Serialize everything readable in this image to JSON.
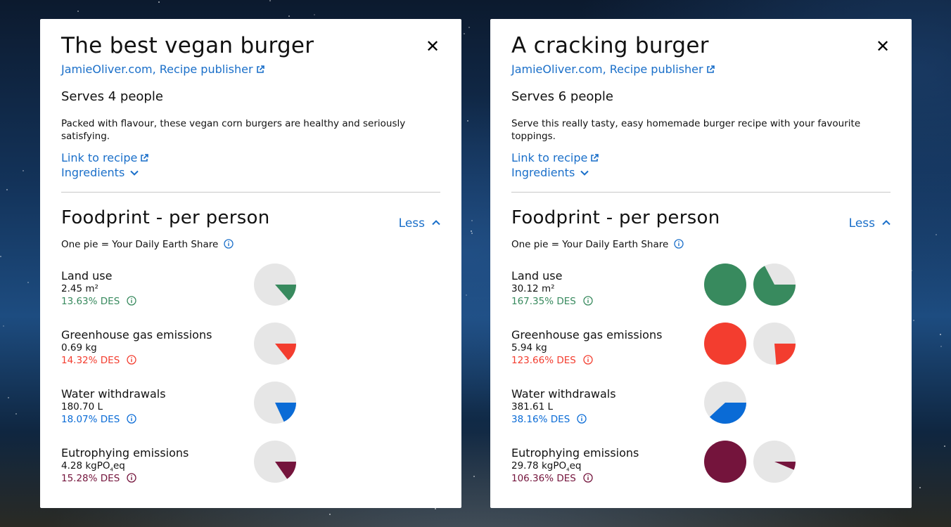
{
  "colors": {
    "link": "#1a6fc9",
    "land": "#388a5e",
    "ghg": "#f33d2f",
    "water": "#0a6bd6",
    "eutro": "#74143c",
    "pie_bg": "#e6e6e6"
  },
  "cards": [
    {
      "title": "The best vegan burger",
      "close_icon": "close-icon",
      "publisher": "JamieOliver.com, Recipe publisher",
      "serves": "Serves 4 people",
      "description": "Packed with flavour, these vegan corn burgers are healthy and seriously satisfying.",
      "recipe_link": "Link to recipe",
      "ingredients": "Ingredients",
      "foodprint_title": "Foodprint - per person",
      "less": "Less",
      "daily_share": "One pie = Your Daily Earth Share",
      "metrics": [
        {
          "name": "Land use",
          "value": "2.45 m²",
          "value_sub": "",
          "value_suffix": "",
          "des": "13.63% DES",
          "color_key": "land",
          "fraction": 0.1363
        },
        {
          "name": "Greenhouse gas emissions",
          "value": "0.69 kg",
          "value_sub": "",
          "value_suffix": "",
          "des": "14.32% DES",
          "color_key": "ghg",
          "fraction": 0.1432
        },
        {
          "name": "Water withdrawals",
          "value": "180.70 L",
          "value_sub": "",
          "value_suffix": "",
          "des": "18.07% DES",
          "color_key": "water",
          "fraction": 0.1807
        },
        {
          "name": "Eutrophying emissions",
          "value": "4.28 kgPO",
          "value_sub": "4",
          "value_suffix": "eq",
          "des": "15.28% DES",
          "color_key": "eutro",
          "fraction": 0.1528
        }
      ]
    },
    {
      "title": "A cracking burger",
      "close_icon": "close-icon",
      "publisher": "JamieOliver.com, Recipe publisher",
      "serves": "Serves 6 people",
      "description": "Serve this really tasty, easy homemade burger recipe with your favourite toppings.",
      "recipe_link": "Link to recipe",
      "ingredients": "Ingredients",
      "foodprint_title": "Foodprint - per person",
      "less": "Less",
      "daily_share": "One pie = Your Daily Earth Share",
      "metrics": [
        {
          "name": "Land use",
          "value": "30.12 m²",
          "value_sub": "",
          "value_suffix": "",
          "des": "167.35% DES",
          "color_key": "land",
          "fraction": 1.6735
        },
        {
          "name": "Greenhouse gas emissions",
          "value": "5.94 kg",
          "value_sub": "",
          "value_suffix": "",
          "des": "123.66% DES",
          "color_key": "ghg",
          "fraction": 1.2366
        },
        {
          "name": "Water withdrawals",
          "value": "381.61 L",
          "value_sub": "",
          "value_suffix": "",
          "des": "38.16% DES",
          "color_key": "water",
          "fraction": 0.3816
        },
        {
          "name": "Eutrophying emissions",
          "value": "29.78 kgPO",
          "value_sub": "4",
          "value_suffix": "eq",
          "des": "106.36% DES",
          "color_key": "eutro",
          "fraction": 1.0636
        }
      ]
    }
  ]
}
